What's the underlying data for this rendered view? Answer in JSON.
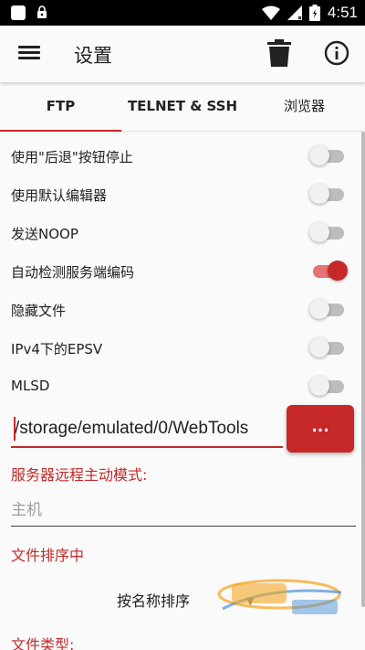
{
  "statusbar": {
    "time": "4:51"
  },
  "appbar": {
    "title": "设置"
  },
  "tabs": [
    {
      "label": "FTP",
      "active": true
    },
    {
      "label": "TELNET & SSH",
      "active": false
    },
    {
      "label": "浏览器",
      "active": false
    }
  ],
  "settings": [
    {
      "label": "使用\"后退\"按钮停止",
      "on": false
    },
    {
      "label": "使用默认编辑器",
      "on": false
    },
    {
      "label": "发送NOOP",
      "on": false
    },
    {
      "label": "自动检测服务端编码",
      "on": true
    },
    {
      "label": "隐藏文件",
      "on": false
    },
    {
      "label": "IPv4下的EPSV",
      "on": false
    },
    {
      "label": "MLSD",
      "on": false
    }
  ],
  "path": {
    "value": "/storage/emulated/0/WebTools",
    "browse_label": "..."
  },
  "server_mode": {
    "heading": "服务器远程主动模式:",
    "host_placeholder": "主机"
  },
  "sorting": {
    "heading": "文件排序中",
    "selected": "按名称排序"
  },
  "file_types": {
    "heading": "文件类型:"
  },
  "colors": {
    "accent": "#c62828",
    "statusbar": "#000000"
  }
}
